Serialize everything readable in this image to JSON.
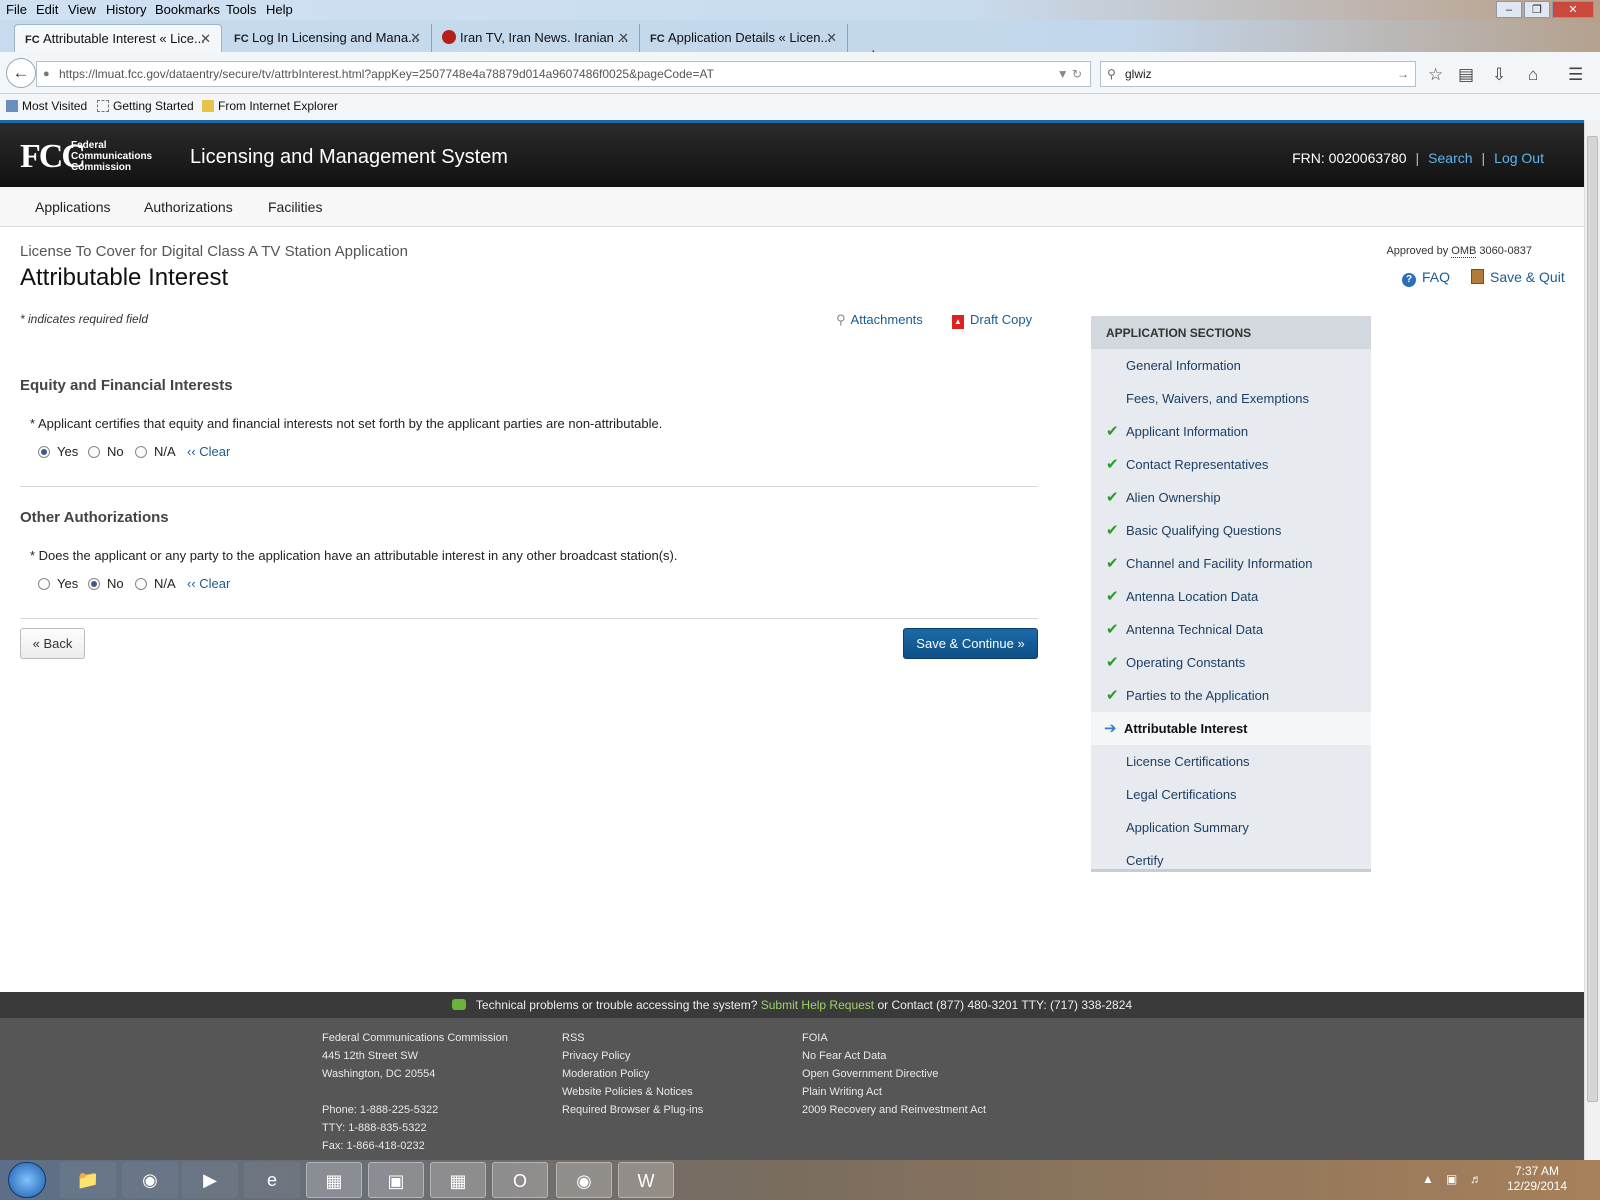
{
  "browser": {
    "menu": [
      "File",
      "Edit",
      "View",
      "History",
      "Bookmarks",
      "Tools",
      "Help"
    ],
    "tabs": [
      {
        "title": "Attributable Interest « Lice..."
      },
      {
        "title": "Log In Licensing and Mana..."
      },
      {
        "title": "Iran TV, Iran News. Iranian ..."
      },
      {
        "title": "Application Details « Licen..."
      }
    ],
    "url": "https://lmuat.fcc.gov/dataentry/secure/tv/attrbInterest.html?appKey=2507748e4a78879d014a9607486f0025&pageCode=AT",
    "search_value": "glwiz",
    "bookmarks": [
      "Most Visited",
      "Getting Started",
      "From Internet Explorer"
    ]
  },
  "header": {
    "logo": "FCC",
    "logo_text": [
      "Federal",
      "Communications",
      "Commission"
    ],
    "system_title": "Licensing and Management System",
    "frn": "FRN: 0020063780",
    "search": "Search",
    "logout": "Log Out"
  },
  "nav": [
    "Applications",
    "Authorizations",
    "Facilities"
  ],
  "page": {
    "app_type": "License To Cover for Digital Class A TV Station Application",
    "title": "Attributable Interest",
    "omb_prefix": "Approved by",
    "omb_abbr": "OMB",
    "omb_number": "3060-0837",
    "faq": "FAQ",
    "save_quit": "Save & Quit",
    "required_note": "* indicates required field",
    "attachments": "Attachments",
    "draft_copy": "Draft Copy",
    "back": "« Back",
    "save_continue": "Save & Continue »"
  },
  "sections": [
    {
      "heading": "Equity and Financial Interests",
      "question": "* Applicant certifies that equity and financial interests not set forth by the applicant parties are non-attributable.",
      "options": [
        "Yes",
        "No",
        "N/A"
      ],
      "selected": "Yes",
      "clear": "‹‹ Clear"
    },
    {
      "heading": "Other Authorizations",
      "question": "* Does the applicant or any party to the application have an attributable interest in any other broadcast station(s).",
      "options": [
        "Yes",
        "No",
        "N/A"
      ],
      "selected": "No",
      "clear": "‹‹ Clear"
    }
  ],
  "app_sections": {
    "heading": "APPLICATION SECTIONS",
    "items": [
      {
        "label": "General Information",
        "state": "none"
      },
      {
        "label": "Fees, Waivers, and Exemptions",
        "state": "none"
      },
      {
        "label": "Applicant Information",
        "state": "complete"
      },
      {
        "label": "Contact Representatives",
        "state": "complete"
      },
      {
        "label": "Alien Ownership",
        "state": "complete"
      },
      {
        "label": "Basic Qualifying Questions",
        "state": "complete"
      },
      {
        "label": "Channel and Facility Information",
        "state": "complete"
      },
      {
        "label": "Antenna Location Data",
        "state": "complete"
      },
      {
        "label": "Antenna Technical Data",
        "state": "complete"
      },
      {
        "label": "Operating Constants",
        "state": "complete"
      },
      {
        "label": "Parties to the Application",
        "state": "complete"
      },
      {
        "label": "Attributable Interest",
        "state": "current"
      },
      {
        "label": "License Certifications",
        "state": "none"
      },
      {
        "label": "Legal Certifications",
        "state": "none"
      },
      {
        "label": "Application Summary",
        "state": "none"
      },
      {
        "label": "Certify",
        "state": "none"
      }
    ]
  },
  "footer": {
    "bar_prefix": "Technical problems or trouble accessing the system?",
    "bar_link": "Submit Help Request",
    "bar_suffix": "or Contact (877) 480-3201 TTY: (717) 338-2824",
    "col1": [
      "Federal Communications Commission",
      "445 12th Street SW",
      "Washington, DC 20554",
      "",
      "Phone: 1-888-225-5322",
      "TTY: 1-888-835-5322",
      "Fax: 1-866-418-0232"
    ],
    "col2": [
      "RSS",
      "Privacy Policy",
      "Moderation Policy",
      "Website Policies & Notices",
      "Required Browser & Plug-ins"
    ],
    "col3": [
      "FOIA",
      "No Fear Act Data",
      "Open Government Directive",
      "Plain Writing Act",
      "2009 Recovery and Reinvestment Act"
    ]
  },
  "taskbar": {
    "time": "7:37 AM",
    "date": "12/29/2014",
    "apps": [
      "windows-explorer",
      "chrome",
      "media-player",
      "internet-explorer",
      "remote-desktop",
      "network-tool",
      "calculator",
      "outlook",
      "firefox",
      "word"
    ]
  },
  "colors": {
    "link": "#1a5c93",
    "primary_button": "#0d4f86",
    "check": "#2a9a2a",
    "header_bg": "#1b1b1b"
  }
}
